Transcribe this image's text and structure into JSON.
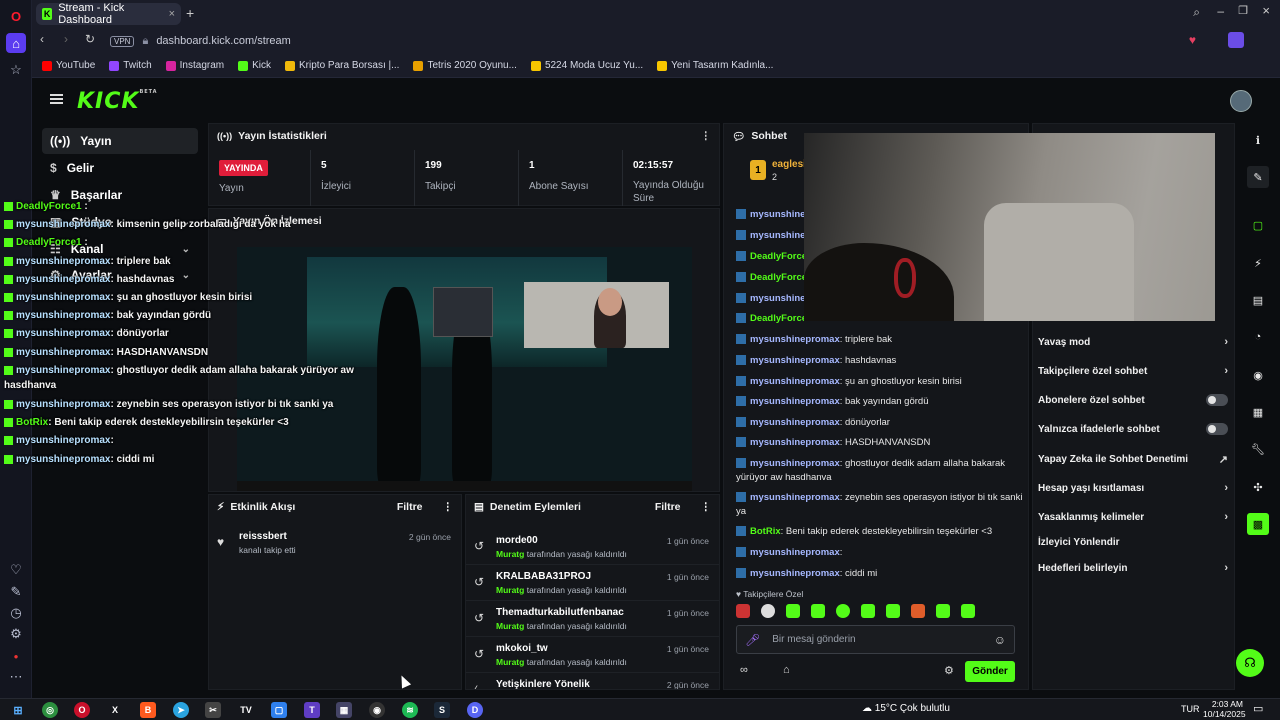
{
  "browser": {
    "tab_title": "Stream - Kick Dashboard",
    "vpn_label": "VPN",
    "url": "dashboard.kick.com/stream",
    "bookmarks": [
      "YouTube",
      "Twitch",
      "Instagram",
      "Kick",
      "Kripto Para Borsası |...",
      "Tetris 2020 Oyunu...",
      "5224 Moda Ucuz Yu...",
      "Yeni Tasarım Kadınla..."
    ]
  },
  "kick": {
    "logo": "KICK",
    "logo_beta": "BETA",
    "nav": [
      "Yayın",
      "Gelir",
      "Başarılar",
      "Stüdyo",
      "Kanal",
      "Ayarlar"
    ]
  },
  "stats_panel": {
    "title": "Yayın İstatistikleri",
    "live_badge": "YAYINDA",
    "live_label": "Yayın",
    "viewers_value": "5",
    "viewers_label": "İzleyici",
    "followers_value": "199",
    "followers_label": "Takipçi",
    "subs_value": "1",
    "subs_label": "Abone Sayısı",
    "duration_value": "02:15:57",
    "duration_label": "Yayında Olduğu Süre"
  },
  "preview_panel": {
    "title": "Yayın Ön İzlemesi"
  },
  "activity": {
    "title": "Etkinlik Akışı",
    "filter": "Filtre",
    "items": [
      {
        "user": "reisssbert",
        "action": "kanalı takip etti",
        "time": "2 gün önce"
      }
    ]
  },
  "moderation": {
    "title": "Denetim Eylemleri",
    "filter": "Filtre",
    "items": [
      {
        "user": "morde00",
        "mod": "Muratg",
        "action": "tarafından yasağı kaldırıldı",
        "time": "1 gün önce"
      },
      {
        "user": "KRALBABA31PROJ",
        "mod": "Muratg",
        "action": "tarafından yasağı kaldırıldı",
        "time": "1 gün önce"
      },
      {
        "user": "Themadturkabilutfenbanac",
        "mod": "Muratg",
        "action": "tarafından yasağı kaldırıldı",
        "time": "1 gün önce"
      },
      {
        "user": "mkokoi_tw",
        "mod": "Muratg",
        "action": "tarafından yasağı kaldırıldı",
        "time": "1 gün önce"
      },
      {
        "user": "Yetişkinlere Yönelik",
        "mod": "",
        "action": "",
        "time": "2 gün önce"
      }
    ]
  },
  "chat": {
    "title": "Sohbet",
    "top_user": "eaglesi",
    "top_count": "2",
    "lines": [
      {
        "user": "mysunshinepro",
        "text": ""
      },
      {
        "user": "mysunshinepro",
        "text": ""
      },
      {
        "user": "DeadlyForce",
        "text": "",
        "green": true
      },
      {
        "user": "DeadlyForce",
        "text": "",
        "green": true
      },
      {
        "user": "mysunshine",
        "text": ""
      },
      {
        "user": "DeadlyForce",
        "text": "",
        "green": true
      },
      {
        "user": "mysunshinepromax",
        "text": ": triplere bak"
      },
      {
        "user": "mysunshinepromax",
        "text": ": hashdavnas"
      },
      {
        "user": "mysunshinepromax",
        "text": ": şu an ghostluyor kesin birisi"
      },
      {
        "user": "mysunshinepromax",
        "text": ": bak yayından gördü"
      },
      {
        "user": "mysunshinepromax",
        "text": ": dönüyorlar"
      },
      {
        "user": "mysunshinepromax",
        "text": ": HASDHANVANSDN"
      },
      {
        "user": "mysunshinepromax",
        "text": ": ghostluyor dedik adam allaha bakarak"
      },
      {
        "user": "",
        "text": "yürüyor aw hasdhanva"
      },
      {
        "user": "mysunshinepromax",
        "text": ": zeynebin ses operasyon istiyor bi tık sanki"
      },
      {
        "user": "",
        "text": "ya"
      },
      {
        "user": "BotRix",
        "text": ": Beni takip ederek destekleyebilirsin teşekürler <3",
        "green": true
      },
      {
        "user": "mysunshinepromax",
        "text": ":"
      },
      {
        "user": "mysunshinepromax",
        "text": ": ciddi mi"
      }
    ],
    "followers_only": "Takipçilere Özel",
    "input_placeholder": "Bir mesaj gönderin",
    "send": "Gönder"
  },
  "chat_settings": {
    "rows": [
      {
        "label": "Yavaş mod",
        "control": "chevron"
      },
      {
        "label": "Takipçilere özel sohbet",
        "control": "chevron"
      },
      {
        "label": "Abonelere özel sohbet",
        "control": "toggle"
      },
      {
        "label": "Yalnızca ifadelerle sohbet",
        "control": "toggle"
      },
      {
        "label": "Yapay Zeka ile Sohbet Denetimi",
        "control": "external"
      },
      {
        "label": "Hesap yaşı kısıtlaması",
        "control": "chevron"
      },
      {
        "label": "Yasaklanmış kelimeler",
        "control": "chevron"
      },
      {
        "label": "İzleyici Yönlendir",
        "control": "none"
      },
      {
        "label": "Hedefleri belirleyin",
        "control": "chevron"
      }
    ]
  },
  "overlay_chat": [
    {
      "user": "DeadlyForce1",
      "text": " :"
    },
    {
      "user": "mysunshinepromax",
      "text": ": kimsenin gelip zorbaladığı da yok ha"
    },
    {
      "user": "DeadlyForce1",
      "text": " :"
    },
    {
      "user": "mysunshinepromax",
      "text": ": triplere bak"
    },
    {
      "user": "mysunshinepromax",
      "text": ": hashdavnas"
    },
    {
      "user": "mysunshinepromax",
      "text": ": şu an ghostluyor kesin birisi"
    },
    {
      "user": "mysunshinepromax",
      "text": ": bak yayından gördü"
    },
    {
      "user": "mysunshinepromax",
      "text": ": dönüyorlar"
    },
    {
      "user": "mysunshinepromax",
      "text": ": HASDHANVANSDN"
    },
    {
      "user": "mysunshinepromax",
      "text": ": ghostluyor dedik adam allaha bakarak yürüyor aw"
    },
    {
      "user": "",
      "text": "hasdhanva"
    },
    {
      "user": "mysunshinepromax",
      "text": ": zeynebin ses operasyon istiyor bi tık sanki ya"
    },
    {
      "user": "BotRix",
      "text": ": Beni takip ederek destekleyebilirsin teşekürler <3"
    },
    {
      "user": "mysunshinepromax",
      "text": ":"
    },
    {
      "user": "mysunshinepromax",
      "text": ": ciddi mi"
    }
  ],
  "taskbar": {
    "weather": "15°C  Çok bulutlu",
    "lang": "TUR",
    "time": "2:03 AM",
    "date": "10/14/2025"
  }
}
